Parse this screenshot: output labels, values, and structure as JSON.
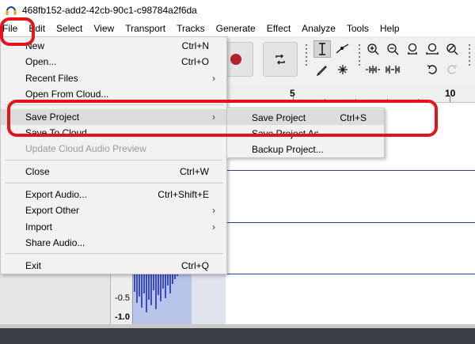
{
  "window": {
    "title": "468fb152-add2-42cb-90c1-c98784a2f6da"
  },
  "menubar": {
    "items": [
      "File",
      "Edit",
      "Select",
      "View",
      "Transport",
      "Tracks",
      "Generate",
      "Effect",
      "Analyze",
      "Tools",
      "Help"
    ]
  },
  "file_menu": {
    "items": [
      {
        "label": "New",
        "shortcut": "Ctrl+N"
      },
      {
        "label": "Open...",
        "shortcut": "Ctrl+O"
      },
      {
        "label": "Recent Files",
        "submenu": true
      },
      {
        "label": "Open From Cloud..."
      },
      {
        "label": "Save Project",
        "submenu": true,
        "highlighted": true
      },
      {
        "label": "Save To Cloud..."
      },
      {
        "label": "Update Cloud Audio Preview",
        "disabled": true
      },
      {
        "label": "Close",
        "shortcut": "Ctrl+W"
      },
      {
        "label": "Export Audio...",
        "shortcut": "Ctrl+Shift+E"
      },
      {
        "label": "Export Other",
        "submenu": true
      },
      {
        "label": "Import",
        "submenu": true
      },
      {
        "label": "Share Audio..."
      },
      {
        "label": "Exit",
        "shortcut": "Ctrl+Q"
      }
    ],
    "submenu_arrow": "›"
  },
  "save_submenu": {
    "items": [
      {
        "label": "Save Project",
        "shortcut": "Ctrl+S",
        "highlighted": true
      },
      {
        "label": "Save Project As..."
      },
      {
        "label": "Backup Project..."
      }
    ]
  },
  "ruler": {
    "labels": [
      "5",
      "10"
    ]
  },
  "track": {
    "scale_labels": [
      "-0.5",
      "-1.0"
    ]
  },
  "colors": {
    "annotation": "#e3141b",
    "record": "#b1232c",
    "waveform": "#3c4cc0",
    "selection": "#b8c4ea"
  },
  "icons": [
    "audacity-app-icon",
    "record-icon",
    "loop-icon",
    "selection-tool-icon",
    "envelope-tool-icon",
    "draw-tool-icon",
    "multi-tool-icon",
    "zoom-in-icon",
    "zoom-out-icon",
    "fit-selection-icon",
    "fit-project-icon",
    "zoom-toggle-icon",
    "trim-icon",
    "silence-icon",
    "undo-icon",
    "redo-icon"
  ]
}
